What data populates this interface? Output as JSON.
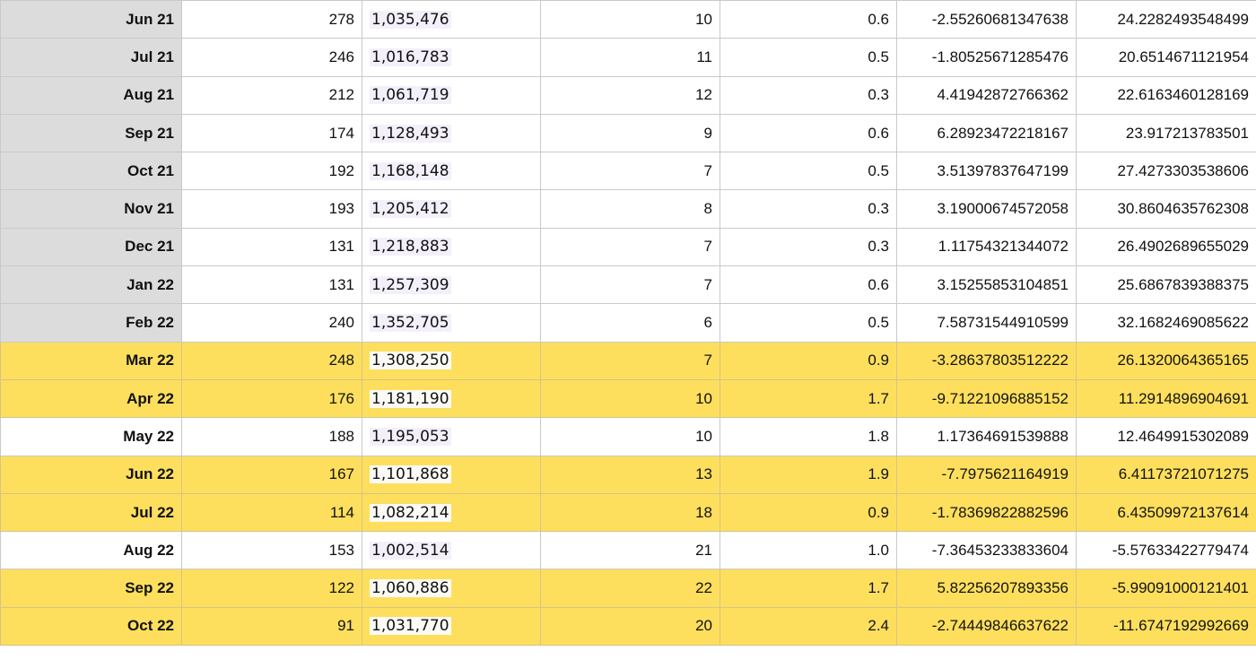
{
  "sheet": {
    "rows": [
      {
        "style": "grey",
        "cells": [
          "Jun 21",
          "278",
          "1,035,476",
          "10",
          "0.6",
          "-2.55260681347638",
          "24.2282493548499"
        ]
      },
      {
        "style": "grey",
        "cells": [
          "Jul 21",
          "246",
          "1,016,783",
          "11",
          "0.5",
          "-1.80525671285476",
          "20.6514671121954"
        ]
      },
      {
        "style": "grey",
        "cells": [
          "Aug 21",
          "212",
          "1,061,719",
          "12",
          "0.3",
          "4.41942872766362",
          "22.6163460128169"
        ]
      },
      {
        "style": "grey",
        "cells": [
          "Sep 21",
          "174",
          "1,128,493",
          "9",
          "0.6",
          "6.28923472218167",
          "23.917213783501"
        ]
      },
      {
        "style": "grey",
        "cells": [
          "Oct 21",
          "192",
          "1,168,148",
          "7",
          "0.5",
          "3.51397837647199",
          "27.4273303538606"
        ]
      },
      {
        "style": "grey",
        "cells": [
          "Nov 21",
          "193",
          "1,205,412",
          "8",
          "0.3",
          "3.19000674572058",
          "30.8604635762308"
        ]
      },
      {
        "style": "grey",
        "cells": [
          "Dec 21",
          "131",
          "1,218,883",
          "7",
          "0.3",
          "1.11754321344072",
          "26.4902689655029"
        ]
      },
      {
        "style": "grey",
        "cells": [
          "Jan 22",
          "131",
          "1,257,309",
          "7",
          "0.6",
          "3.15255853104851",
          "25.6867839388375"
        ]
      },
      {
        "style": "grey",
        "cells": [
          "Feb 22",
          "240",
          "1,352,705",
          "6",
          "0.5",
          "7.58731544910599",
          "32.1682469085622"
        ]
      },
      {
        "style": "yellow",
        "cells": [
          "Mar 22",
          "248",
          "1,308,250",
          "7",
          "0.9",
          "-3.28637803512222",
          "26.1320064365165"
        ]
      },
      {
        "style": "yellow",
        "cells": [
          "Apr 22",
          "176",
          "1,181,190",
          "10",
          "1.7",
          "-9.71221096885152",
          "11.2914896904691"
        ]
      },
      {
        "style": "white",
        "cells": [
          "May 22",
          "188",
          "1,195,053",
          "10",
          "1.8",
          "1.17364691539888",
          "12.4649915302089"
        ]
      },
      {
        "style": "yellow",
        "cells": [
          "Jun 22",
          "167",
          "1,101,868",
          "13",
          "1.9",
          "-7.7975621164919",
          "6.41173721071275"
        ]
      },
      {
        "style": "yellow",
        "cells": [
          "Jul 22",
          "114",
          "1,082,214",
          "18",
          "0.9",
          "-1.78369822882596",
          "6.43509972137614"
        ]
      },
      {
        "style": "white",
        "cells": [
          "Aug 22",
          "153",
          "1,002,514",
          "21",
          "1.0",
          "-7.36453233833604",
          "-5.57633422779474"
        ]
      },
      {
        "style": "yellow",
        "cells": [
          "Sep 22",
          "122",
          "1,060,886",
          "22",
          "1.7",
          "5.82256207893356",
          "-5.99091000121401"
        ]
      },
      {
        "style": "yellow",
        "cells": [
          "Oct 22",
          "91",
          "1,031,770",
          "20",
          "2.4",
          "-2.74449846637622",
          "-11.6747192992669"
        ]
      }
    ],
    "colors": {
      "row_highlight": "#fddf5d",
      "header_grey": "#dcdcdc",
      "value_shade": "#f3f0fb"
    }
  }
}
